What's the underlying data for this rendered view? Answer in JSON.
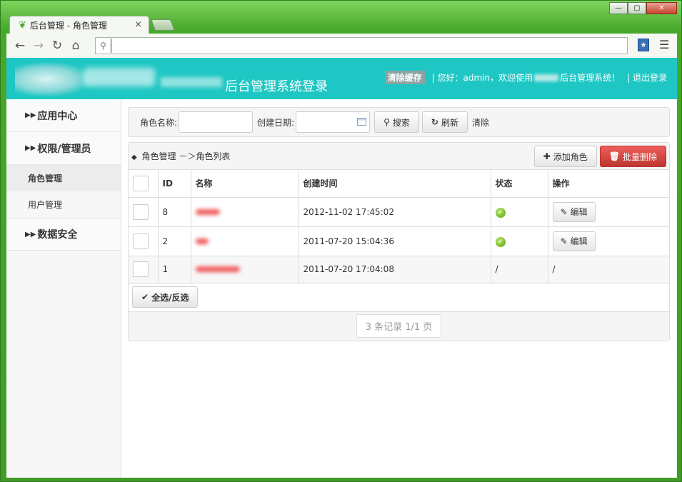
{
  "browser": {
    "tab_title": "后台管理 - 角色管理",
    "tab_close": "×",
    "url": "",
    "win_min": "—",
    "win_max": "▢",
    "win_close": "✕"
  },
  "header": {
    "site_title": "后台管理系统登录",
    "clear_cache": "清除缓存",
    "greeting_prefix": "| 您好：",
    "username": "admin",
    "greeting_mid": "，欢迎使用",
    "greeting_suffix": "后台管理系统！",
    "logout": "| 退出登录"
  },
  "sidebar": {
    "groups": [
      {
        "label": "应用中心"
      },
      {
        "label": "权限/管理员"
      },
      {
        "label": "数据安全"
      }
    ],
    "sub_items": [
      {
        "label": "角色管理"
      },
      {
        "label": "用户管理"
      }
    ]
  },
  "search": {
    "role_name_label": "角色名称:",
    "date_label": "创建日期:",
    "search_btn": "搜索",
    "refresh_btn": "刷新",
    "clear_link": "清除"
  },
  "panel": {
    "breadcrumb": "角色管理 －＞角色列表",
    "add_btn": "添加角色",
    "batch_delete_btn": "批量删除"
  },
  "table": {
    "headers": [
      "ID",
      "名称",
      "创建时间",
      "状态",
      "操作"
    ],
    "rows": [
      {
        "id": "8",
        "created": "2012-11-02 17:45:02",
        "status": "ok",
        "action": "编辑"
      },
      {
        "id": "2",
        "created": "2011-07-20 15:04:36",
        "status": "ok",
        "action": "编辑"
      },
      {
        "id": "1",
        "created": "2011-07-20 17:04:08",
        "status": "/",
        "action": "/"
      }
    ]
  },
  "footer": {
    "select_all": "全选/反选",
    "pager": "3 条记录 1/1 页"
  },
  "colors": {
    "header_bg": "#1fc7c4",
    "danger": "#d9534f",
    "status_ok": "#6ab31c"
  }
}
